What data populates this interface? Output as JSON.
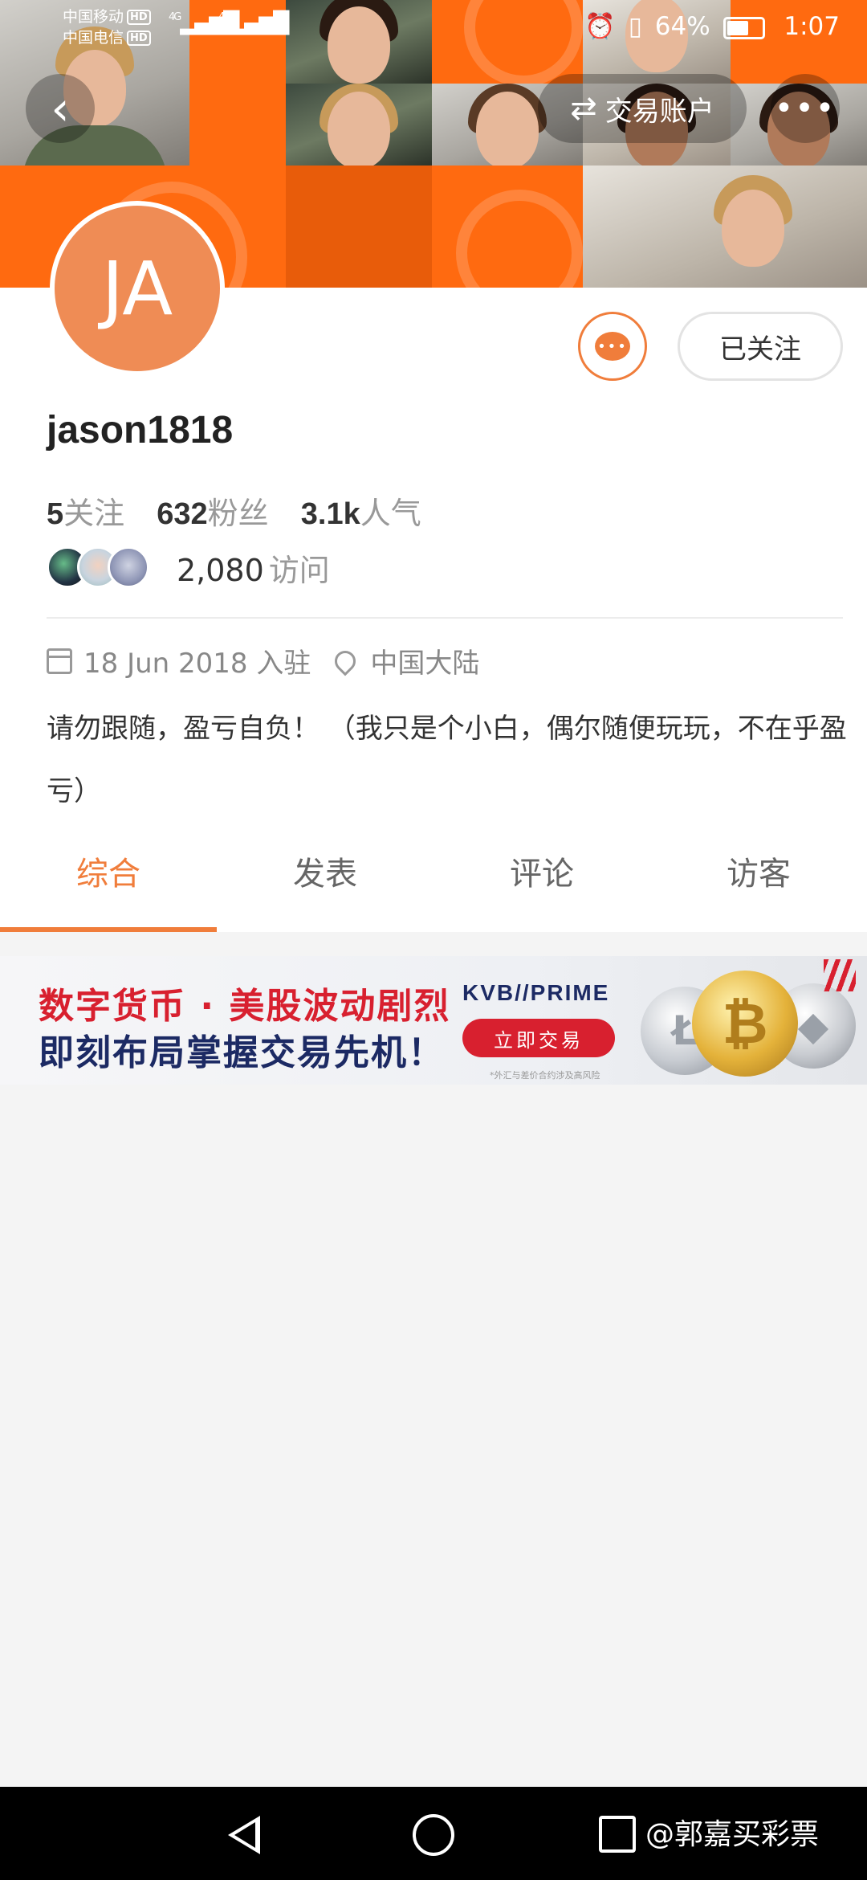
{
  "status_bar": {
    "carrier1": "中国移动",
    "carrier2": "中国电信",
    "hd": "HD",
    "network": "4G",
    "battery_pct": "64%",
    "time": "1:07"
  },
  "header": {
    "trade_label": "交易账户",
    "more_label": "•••"
  },
  "profile": {
    "avatar_initials": "JA",
    "follow_label": "已关注",
    "username": "jason1818",
    "following_count": "5",
    "following_label": "关注",
    "fans_count": "632",
    "fans_label": "粉丝",
    "popularity_count": "3.1k",
    "popularity_label": "人气",
    "visits_count": "2,080",
    "visits_label": "访问",
    "join_date": "18 Jun 2018 入驻",
    "location": "中国大陆",
    "bio": "请勿跟随，盈亏自负！ （我只是个小白，偶尔随便玩玩，不在乎盈亏）"
  },
  "tabs": [
    {
      "label": "综合",
      "active": true
    },
    {
      "label": "发表",
      "active": false
    },
    {
      "label": "评论",
      "active": false
    },
    {
      "label": "访客",
      "active": false
    }
  ],
  "ad": {
    "line1": "数字货币 · 美股波动剧烈",
    "line2": "即刻布局掌握交易先机！",
    "brand": "KVB//PRIME",
    "cta": "立即交易",
    "note": "*外汇与差价合约涉及高风险"
  },
  "watermark": "@郭嘉买彩票",
  "colors": {
    "accent": "#f07d3b",
    "cover_orange": "#ff6a10",
    "ad_red": "#d8202f",
    "ad_navy": "#1c2a64"
  }
}
